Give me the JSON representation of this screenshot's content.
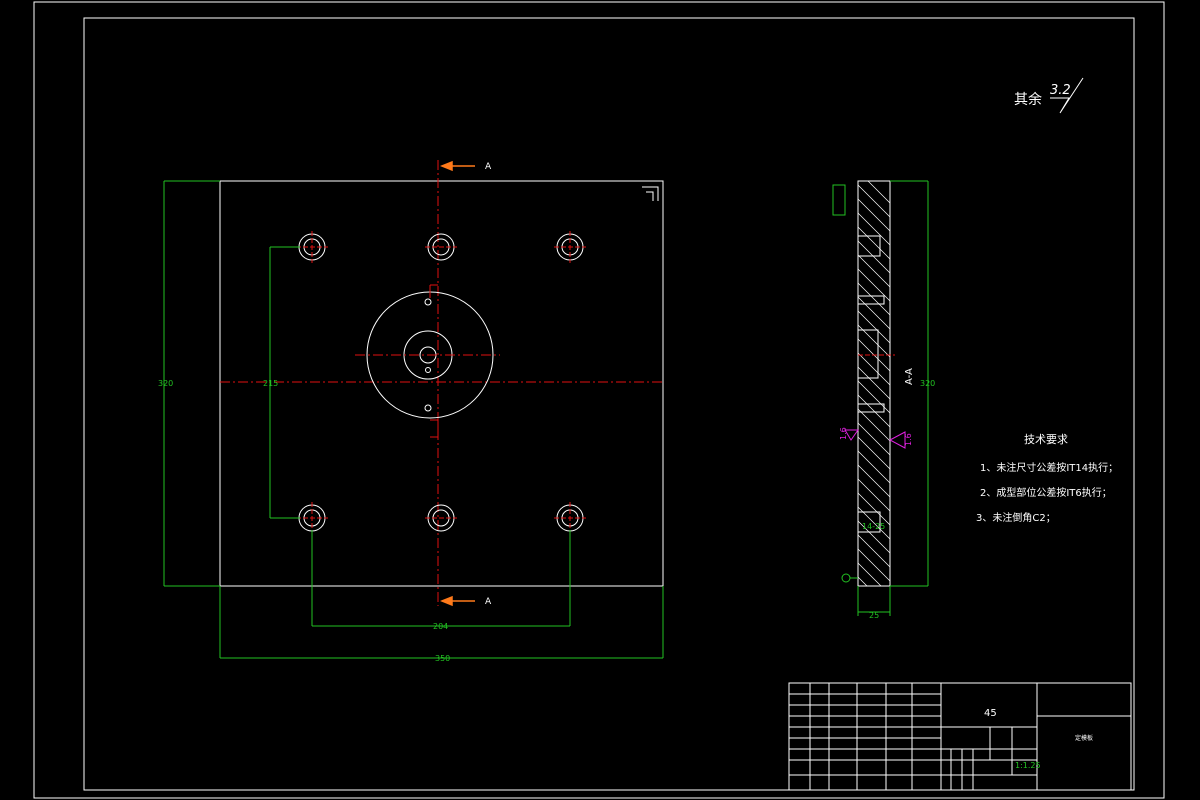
{
  "drawing": {
    "roughness_note": "其余",
    "roughness_value": "3.2",
    "section_marker": "A",
    "section_label": "A-A",
    "dimensions": {
      "height_left": "320",
      "inner_vertical": "215",
      "hole_span": "204",
      "overall_width": "350",
      "height_side": "320",
      "thickness": "25",
      "chamfer": "14-25"
    },
    "surface_marks": [
      "1.6",
      "1.6"
    ],
    "tech_requirements": {
      "title": "技术要求",
      "items": [
        "1、未注尺寸公差按IT14执行；",
        "2、成型部位公差按IT6执行；",
        "3、未注倒角C2；"
      ]
    },
    "title_block": {
      "material": "45",
      "part_name": "定模板",
      "scale": "1:1.25"
    }
  },
  "colors": {
    "outline": "#ffffff",
    "dimension": "#22c222",
    "centerline": "#e01010",
    "section_arrow": "#ff7a1a",
    "surface": "#e020e0"
  }
}
